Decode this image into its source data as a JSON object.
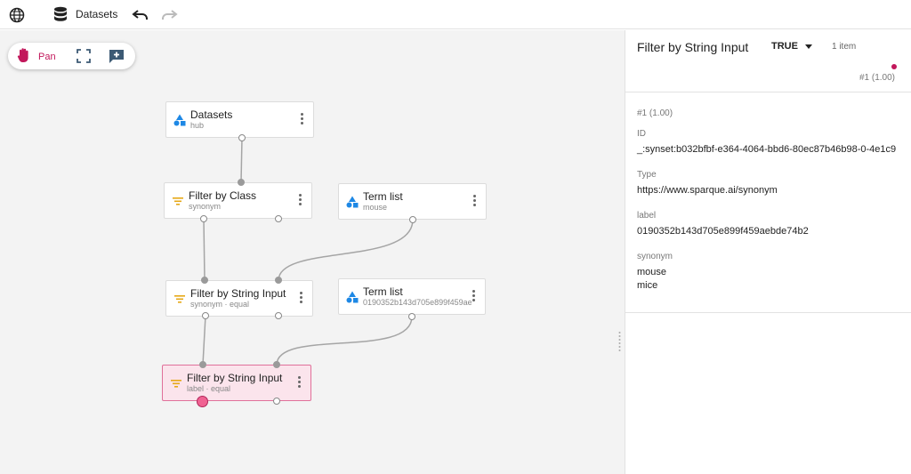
{
  "topbar": {
    "globe_icon": "globe-icon",
    "db_icon": "database-icon",
    "title": "Datasets",
    "undo_icon": "undo-icon",
    "redo_icon": "redo-icon"
  },
  "toolbar": {
    "pan_label": "Pan",
    "pan_icon": "hand-icon",
    "fit_icon": "fit-screen-icon",
    "add_icon": "add-comment-icon"
  },
  "nodes": [
    {
      "title": "Datasets",
      "subtitle": "hub",
      "icon": "shapes-icon"
    },
    {
      "title": "Filter by Class",
      "subtitle": "synonym",
      "icon": "filter-icon"
    },
    {
      "title": "Term list",
      "subtitle": "mouse",
      "icon": "shapes-icon"
    },
    {
      "title": "Filter by String Input",
      "subtitle": "synonym · equal",
      "icon": "filter-icon"
    },
    {
      "title": "Term list",
      "subtitle": "0190352b143d705e899f459aebde74b2",
      "icon": "shapes-icon"
    },
    {
      "title": "Filter by String Input",
      "subtitle": "label · equal",
      "icon": "filter-icon"
    }
  ],
  "panel": {
    "title": "Filter by String Input",
    "dropdown_value": "TRUE",
    "count": "1 item",
    "rank_top": "#1 (1.00)",
    "rank": "#1 (1.00)",
    "fields": [
      {
        "label": "ID",
        "values": [
          "_:synset:b032bfbf-e364-4064-bbd6-80ec87b46b98-0-4e1c9"
        ]
      },
      {
        "label": "Type",
        "values": [
          "https://www.sparque.ai/synonym"
        ]
      },
      {
        "label": "label",
        "values": [
          "0190352b143d705e899f459aebde74b2"
        ]
      },
      {
        "label": "synonym",
        "values": [
          "mouse",
          "mice"
        ]
      }
    ]
  },
  "colors": {
    "accent": "#c2185b",
    "selected_bg": "#fbe4ec",
    "dataset_icon": "#1e88e5",
    "filter_icon": "#e6a817"
  }
}
